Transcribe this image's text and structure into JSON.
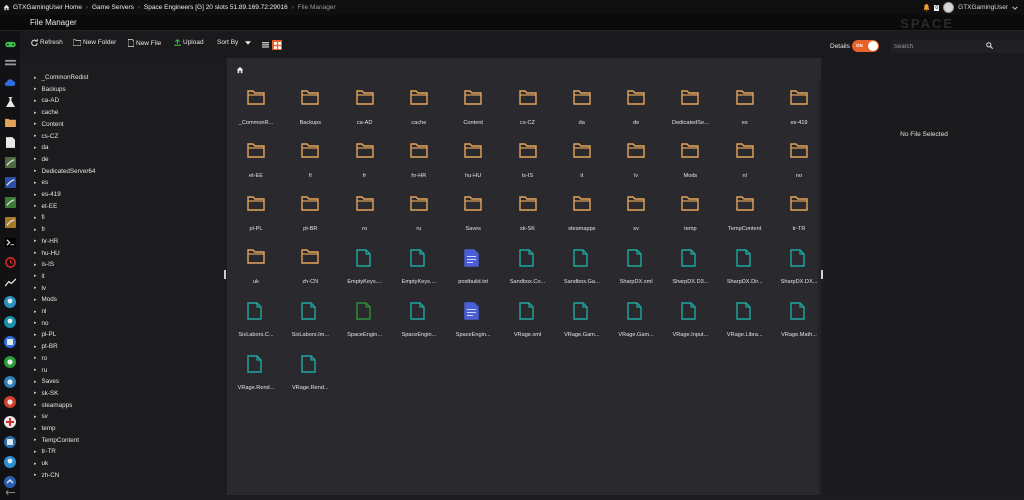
{
  "topbar": {
    "breadcrumbs": [
      "GTXGamingUser Home",
      "Game Servers",
      "Space Engineers [G] 20 slots 51.89.169.72:29016",
      "File Manager"
    ],
    "notification_count": "0",
    "username": "GTXGamingUser"
  },
  "page": {
    "title": "File Manager",
    "watermark": "SPACE"
  },
  "rail": {
    "icons": [
      "gamepad-icon",
      "hosting-icon",
      "cloud-icon",
      "flask-icon",
      "folder-icon",
      "file-icon",
      "steam-icon",
      "steam-blue-icon",
      "steam-green-icon",
      "steam-gold-icon",
      "console-icon",
      "clock-icon",
      "chart-icon",
      "avatar-1-icon",
      "avatar-2-icon",
      "avatar-3-icon",
      "avatar-4-icon",
      "avatar-5-icon",
      "avatar-6-icon",
      "avatar-7-icon",
      "avatar-8-icon",
      "avatar-9-icon",
      "collapse-icon"
    ]
  },
  "toolbar": {
    "refresh": "Refresh",
    "new_folder": "New Folder",
    "new_file": "New File",
    "upload": "Upload",
    "sort_by": "Sort By",
    "details_label": "Details",
    "toggle_label": "ON",
    "search_placeholder": "Search"
  },
  "colors": {
    "accent": "#e8632b",
    "folder": "#e3a45a",
    "file_teal": "#1fa7a1",
    "file_green": "#2f8f3a",
    "file_blue": "#4a5fd6"
  },
  "tree": [
    "_CommonRedist",
    "Backups",
    "ca-AD",
    "cache",
    "Content",
    "cs-CZ",
    "da",
    "de",
    "DedicatedServer64",
    "es",
    "es-419",
    "et-EE",
    "fi",
    "fr",
    "hr-HR",
    "hu-HU",
    "is-IS",
    "it",
    "lv",
    "Mods",
    "nl",
    "no",
    "pl-PL",
    "pt-BR",
    "ro",
    "ru",
    "Saves",
    "sk-SK",
    "steamapps",
    "sv",
    "temp",
    "TempContent",
    "tr-TR",
    "uk",
    "zh-CN"
  ],
  "files": [
    {
      "name": "_CommonR...",
      "type": "folder"
    },
    {
      "name": "Backups",
      "type": "folder"
    },
    {
      "name": "ca-AD",
      "type": "folder"
    },
    {
      "name": "cache",
      "type": "folder"
    },
    {
      "name": "Content",
      "type": "folder"
    },
    {
      "name": "cs-CZ",
      "type": "folder"
    },
    {
      "name": "da",
      "type": "folder"
    },
    {
      "name": "de",
      "type": "folder"
    },
    {
      "name": "DedicatedSe...",
      "type": "folder"
    },
    {
      "name": "es",
      "type": "folder"
    },
    {
      "name": "es-419",
      "type": "folder"
    },
    {
      "name": "et-EE",
      "type": "folder"
    },
    {
      "name": "fi",
      "type": "folder"
    },
    {
      "name": "fr",
      "type": "folder"
    },
    {
      "name": "hr-HR",
      "type": "folder"
    },
    {
      "name": "hu-HU",
      "type": "folder"
    },
    {
      "name": "is-IS",
      "type": "folder"
    },
    {
      "name": "it",
      "type": "folder"
    },
    {
      "name": "lv",
      "type": "folder"
    },
    {
      "name": "Mods",
      "type": "folder"
    },
    {
      "name": "nl",
      "type": "folder"
    },
    {
      "name": "no",
      "type": "folder"
    },
    {
      "name": "pl-PL",
      "type": "folder"
    },
    {
      "name": "pt-BR",
      "type": "folder"
    },
    {
      "name": "ro",
      "type": "folder"
    },
    {
      "name": "ru",
      "type": "folder"
    },
    {
      "name": "Saves",
      "type": "folder"
    },
    {
      "name": "sk-SK",
      "type": "folder"
    },
    {
      "name": "steamapps",
      "type": "folder"
    },
    {
      "name": "sv",
      "type": "folder"
    },
    {
      "name": "temp",
      "type": "folder"
    },
    {
      "name": "TempContent",
      "type": "folder"
    },
    {
      "name": "tr-TR",
      "type": "folder"
    },
    {
      "name": "uk",
      "type": "folder"
    },
    {
      "name": "zh-CN",
      "type": "folder"
    },
    {
      "name": "EmptyKeys....",
      "type": "file-teal"
    },
    {
      "name": "EmptyKeys....",
      "type": "file-teal"
    },
    {
      "name": "postbuild.txt",
      "type": "file-blue"
    },
    {
      "name": "Sandbox.Co...",
      "type": "file-teal"
    },
    {
      "name": "Sandbox.Ga...",
      "type": "file-teal"
    },
    {
      "name": "SharpDX.xml",
      "type": "file-teal"
    },
    {
      "name": "SharpDX.D3...",
      "type": "file-teal"
    },
    {
      "name": "SharpDX.Dir...",
      "type": "file-teal"
    },
    {
      "name": "SharpDX.DX...",
      "type": "file-teal"
    },
    {
      "name": "SixLabors.C...",
      "type": "file-teal"
    },
    {
      "name": "SixLabors.Im...",
      "type": "file-teal"
    },
    {
      "name": "SpaceEngin...",
      "type": "file-green"
    },
    {
      "name": "SpaceEngin...",
      "type": "file-teal"
    },
    {
      "name": "SpaceEngin...",
      "type": "file-blue"
    },
    {
      "name": "VRage.xml",
      "type": "file-teal"
    },
    {
      "name": "VRage.Gam...",
      "type": "file-teal"
    },
    {
      "name": "VRage.Gam...",
      "type": "file-teal"
    },
    {
      "name": "VRage.Input...",
      "type": "file-teal"
    },
    {
      "name": "VRage.Libra...",
      "type": "file-teal"
    },
    {
      "name": "VRage.Math...",
      "type": "file-teal"
    },
    {
      "name": "VRage.Rend...",
      "type": "file-teal"
    },
    {
      "name": "VRage.Rend...",
      "type": "file-teal"
    }
  ],
  "details": {
    "empty_text": "No File Selected"
  }
}
